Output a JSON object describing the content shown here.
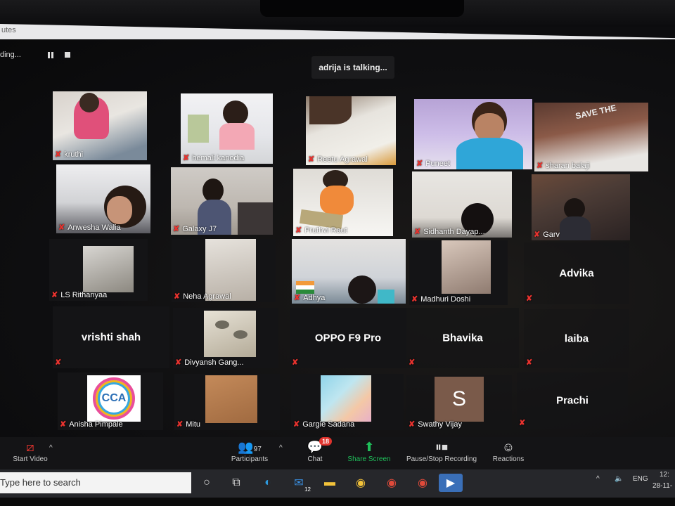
{
  "window": {
    "title": "utes"
  },
  "recording": {
    "status": "ding..."
  },
  "talking_indicator": "adrija is talking...",
  "participants": [
    {
      "name": "kruthi"
    },
    {
      "name": "hemali kanodia"
    },
    {
      "name": "Reetu Agrawal"
    },
    {
      "name": "Puneet"
    },
    {
      "name": "sharan balaji"
    },
    {
      "name": "Anwesha Walia"
    },
    {
      "name": "Galaxy J7"
    },
    {
      "name": "Pruthvi Raut"
    },
    {
      "name": "Sidhanth Dayap..."
    },
    {
      "name": "Garv"
    },
    {
      "name": "LS Rithanyaa"
    },
    {
      "name": "Neha Agrawal"
    },
    {
      "name": "Adhya"
    },
    {
      "name": "Madhuri  Doshi"
    },
    {
      "name": "Advika"
    },
    {
      "name": "vrishti shah"
    },
    {
      "name": "Divyansh Gang..."
    },
    {
      "name": "OPPO F9 Pro"
    },
    {
      "name": "Bhavika"
    },
    {
      "name": "laiba"
    },
    {
      "name": "Anisha Pimpale",
      "avatar_text": "CCA"
    },
    {
      "name": "Mitu"
    },
    {
      "name": "Gargie Sadana"
    },
    {
      "name": "Swathy Vijay",
      "avatar_text": "S"
    },
    {
      "name": "Prachi"
    }
  ],
  "toolbar": {
    "start_video": "Start Video",
    "participants_label": "Participants",
    "participants_count": "97",
    "chat_label": "Chat",
    "chat_badge": "18",
    "share_label": "Share Screen",
    "record_label": "Pause/Stop Recording",
    "reactions_label": "Reactions"
  },
  "taskbar": {
    "search_placeholder": "Type here to search",
    "mail_badge": "12",
    "lang": "ENG",
    "time": "12:",
    "date": "28-11-"
  },
  "colors": {
    "mic_off": "#e8332f",
    "share_green": "#1fbf5a",
    "chat_badge": "#e0332d"
  }
}
